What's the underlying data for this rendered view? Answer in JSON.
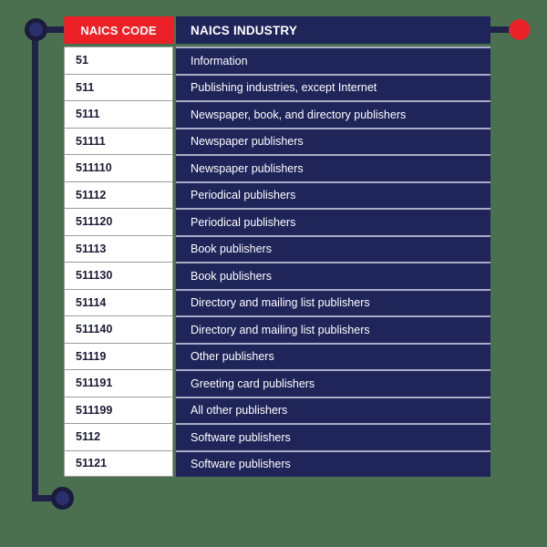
{
  "theme": {
    "background": "#4a7050",
    "accent_red": "#ec2027",
    "navy": "#1f2459",
    "node_navy_fill": "#2a2f6e",
    "node_navy_ring": "#1a1c3d",
    "separator": "#a9adc8",
    "code_border": "#9a9a9a",
    "code_text": "#1b1b36"
  },
  "decorations": {
    "top_left_node": "circle-node-icon",
    "bottom_left_node": "circle-node-icon",
    "top_right_node": "red-dot-icon",
    "vertical_connector": "connector-line",
    "bottom_connector": "connector-line",
    "top_left_connector": "connector-line",
    "top_right_connector": "connector-line"
  },
  "table": {
    "columns": [
      {
        "key": "code",
        "label": "NAICS CODE"
      },
      {
        "key": "industry",
        "label": "NAICS INDUSTRY"
      }
    ],
    "rows": [
      {
        "code": "51",
        "industry": "Information"
      },
      {
        "code": "511",
        "industry": "Publishing industries, except Internet"
      },
      {
        "code": "5111",
        "industry": "Newspaper, book, and directory publishers"
      },
      {
        "code": "51111",
        "industry": "Newspaper publishers"
      },
      {
        "code": "511110",
        "industry": "Newspaper publishers"
      },
      {
        "code": "51112",
        "industry": "Periodical publishers"
      },
      {
        "code": "511120",
        "industry": "Periodical publishers"
      },
      {
        "code": "51113",
        "industry": "Book publishers"
      },
      {
        "code": "511130",
        "industry": "Book publishers"
      },
      {
        "code": "51114",
        "industry": "Directory and mailing list publishers"
      },
      {
        "code": "511140",
        "industry": "Directory and mailing list publishers"
      },
      {
        "code": "51119",
        "industry": "Other publishers"
      },
      {
        "code": "511191",
        "industry": "Greeting card publishers"
      },
      {
        "code": "511199",
        "industry": "All other publishers"
      },
      {
        "code": "5112",
        "industry": "Software publishers"
      },
      {
        "code": "51121",
        "industry": "Software publishers"
      }
    ]
  }
}
